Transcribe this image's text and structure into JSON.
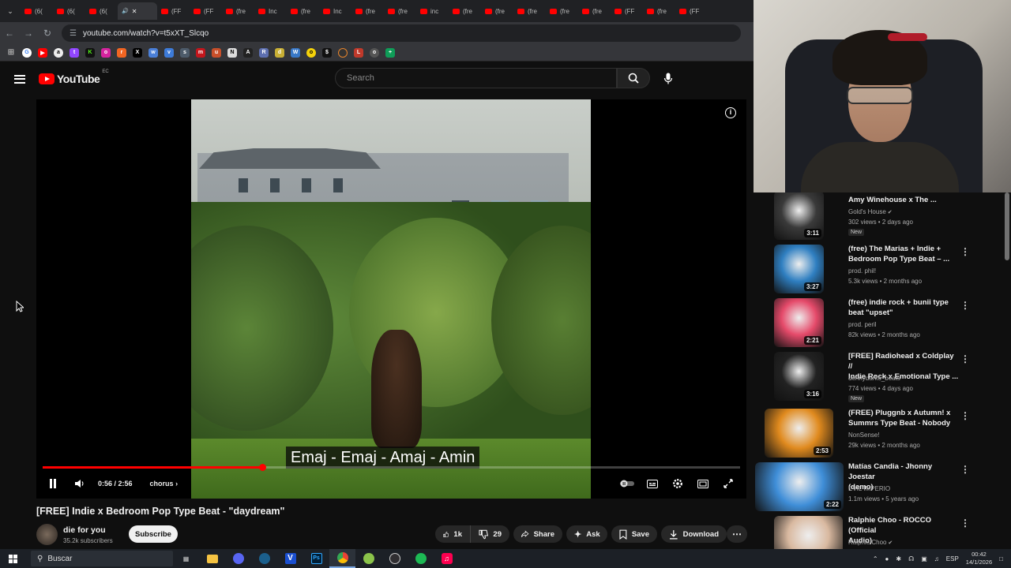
{
  "browser": {
    "tabs": [
      "(6(",
      "(6(",
      "(6(",
      "(fre",
      "(FF",
      "(FF",
      "(fre",
      "Inc",
      "(fre",
      "Inc",
      "(fre",
      "(fre",
      "inc",
      "(fre",
      "(fre",
      "(fre",
      "(fre",
      "(fre",
      "(FF",
      "(fre",
      "(FF"
    ],
    "url": "youtube.com/watch?v=t5xXT_Slcqo"
  },
  "youtube": {
    "logo_text": "YouTube",
    "country": "EC",
    "search_placeholder": "Search"
  },
  "player": {
    "subtitle": "Emaj - Emaj - Amaj - Amin",
    "time": "0:56 / 2:56",
    "chapter": "chorus",
    "progress_fraction": 0.315
  },
  "video": {
    "title": "[FREE] Indie x Bedroom Pop Type Beat - \"daydream\"",
    "channel": "die for you",
    "subscribers": "35.2k subscribers",
    "subscribe_label": "Subscribe",
    "likes": "1k",
    "dislikes": "29",
    "share_label": "Share",
    "ask_label": "Ask",
    "save_label": "Save",
    "download_label": "Download"
  },
  "recommendations": [
    {
      "title_lines": [
        "Amy Winehouse x The ..."
      ],
      "channel": "Gold's House",
      "verified": true,
      "meta": "302 views • 2 days ago",
      "badge": "New",
      "duration": "3:11",
      "thumb_color": "#3a3a3a"
    },
    {
      "title_lines": [
        "(free) The Marias + Indie +",
        "Bedroom Pop Type Beat – ..."
      ],
      "channel": "prod. phil!",
      "verified": false,
      "meta": "5.3k views • 2 months ago",
      "badge": "",
      "duration": "3:27",
      "thumb_color": "#2f7fc1"
    },
    {
      "title_lines": [
        "(free) indie rock + bunii type",
        "beat \"upset\""
      ],
      "channel": "prod. peril",
      "verified": false,
      "meta": "82k views • 2 months ago",
      "badge": "",
      "duration": "2:21",
      "thumb_color": "#e54a6a"
    },
    {
      "title_lines": [
        "[FREE] Radiohead x Coldplay //",
        "Indie Rock x Emotional Type ..."
      ],
      "channel": "dennydarko_beats",
      "verified": false,
      "meta": "774 views • 4 days ago",
      "badge": "New",
      "duration": "3:16",
      "thumb_color": "#222222"
    },
    {
      "title_lines": [
        "(FREE) Pluggnb x Autumn! x",
        "Summrs Type Beat - Nobody"
      ],
      "channel": "NonSense!",
      "verified": false,
      "meta": "29k views • 2 months ago",
      "badge": "",
      "duration": "2:53",
      "thumb_color": "#e08a1e"
    },
    {
      "title_lines": [
        "Matías Candia - Jhonny Joestar",
        "(demo)"
      ],
      "channel": "EVIL IMPERIO",
      "verified": false,
      "meta": "1.1m views • 5 years ago",
      "badge": "",
      "duration": "2:22",
      "thumb_color": "#3f8ed8"
    },
    {
      "title_lines": [
        "Ralphie Choo - ROCCO (Official",
        "Audio)"
      ],
      "channel": "Ralphie Choo",
      "verified": true,
      "meta": "",
      "badge": "",
      "duration": "",
      "thumb_color": "#d9b9a0"
    }
  ],
  "taskbar": {
    "search_label": "Buscar",
    "language": "ESP",
    "time": "00:42",
    "date": "14/1/2026"
  }
}
